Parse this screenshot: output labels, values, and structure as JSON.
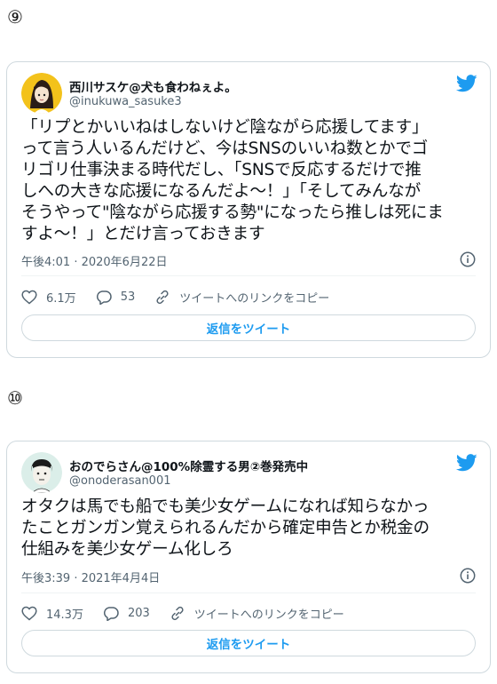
{
  "tweets": [
    {
      "section_marker": "⑨",
      "author_name": "西川サスケ@犬も食わねぇよ。",
      "author_handle": "@inukuwa_sasuke3",
      "text": "「リプとかいいねはしないけど陰ながら応援してます」\nって言う人いるんだけど、今はSNSのいいね数とかでゴ\nリゴリ仕事決まる時代だし、「SNSで反応するだけで推\nしへの大きな応援になるんだよ～！」「そしてみんなが\nそうやって\"陰ながら応援する勢\"になったら推しは死にま\nすよ～！」とだけ言っておきます",
      "timestamp": "午後4:01 · 2020年6月22日",
      "likes": "6.1万",
      "replies": "53",
      "copy_link_label": "ツイートへのリンクをコピー",
      "reply_button_label": "返信をツイート"
    },
    {
      "section_marker": "⑩",
      "author_name": "おのでらさん@100%除霊する男②巻発売中",
      "author_handle": "@onoderasan001",
      "text": "オタクは馬でも船でも美少女ゲームになれば知らなかっ\nたことガンガン覚えられるんだから確定申告とか税金の\n仕組みを美少女ゲーム化しろ",
      "timestamp": "午後3:39 · 2021年4月4日",
      "likes": "14.3万",
      "replies": "203",
      "copy_link_label": "ツイートへのリンクをコピー",
      "reply_button_label": "返信をツイート"
    }
  ],
  "icons": {
    "brand": "twitter-bird-icon",
    "like": "heart-icon",
    "reply": "speech-bubble-icon",
    "link": "link-icon",
    "info": "info-icon"
  },
  "colors": {
    "accent": "#1d9bf0",
    "text": "#0f1419",
    "secondary_text": "#536471",
    "border": "#cfd9de"
  }
}
